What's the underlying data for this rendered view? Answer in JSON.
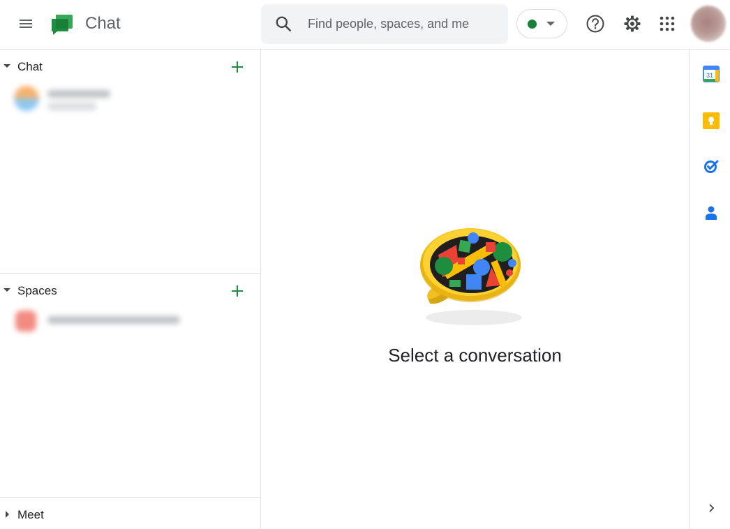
{
  "app": {
    "name": "Chat",
    "brand_color": "#1e8e3e"
  },
  "search": {
    "placeholder": "Find people, spaces, and messages",
    "value": ""
  },
  "status": {
    "state_color": "#188038"
  },
  "topbar_icons": [
    "menu-icon",
    "search-icon",
    "help-icon",
    "gear-icon",
    "apps-grid-icon",
    "avatar"
  ],
  "leftnav": {
    "sections": [
      {
        "title": "Chat",
        "expanded": true
      },
      {
        "title": "Spaces",
        "expanded": true
      },
      {
        "title": "Meet",
        "expanded": false
      }
    ]
  },
  "main": {
    "empty_state_text": "Select a conversation"
  },
  "right_rail": {
    "apps": [
      "calendar-icon",
      "keep-icon",
      "tasks-icon",
      "contacts-icon"
    ],
    "calendar_day": "31"
  }
}
